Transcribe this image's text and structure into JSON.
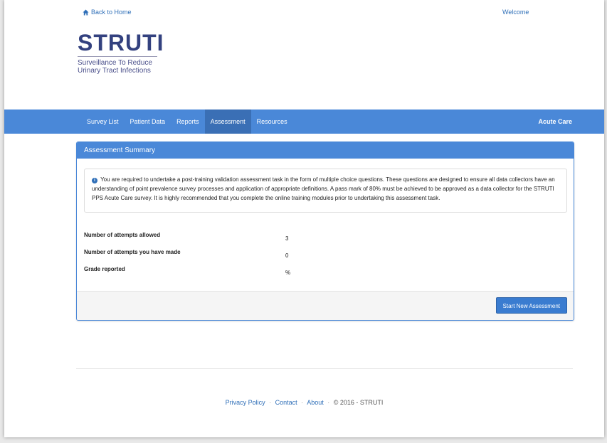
{
  "header": {
    "back_label": "Back to Home",
    "welcome_label": "Welcome"
  },
  "logo": {
    "title": "STRUTI",
    "subtitle_line1": "Surveillance To Reduce",
    "subtitle_line2": "Urinary Tract Infections"
  },
  "nav": {
    "items": [
      {
        "label": "Survey List"
      },
      {
        "label": "Patient Data"
      },
      {
        "label": "Reports"
      },
      {
        "label": "Assessment"
      },
      {
        "label": "Resources"
      }
    ],
    "active_index": 3,
    "right_label": "Acute Care"
  },
  "panel": {
    "heading": "Assessment Summary",
    "info_text": "You are required to undertake a post-training validation assessment task in the form of multiple choice questions. These questions are designed to ensure all data collectors have an understanding of point prevalence survey processes and application of appropriate definitions. A pass mark of 80% must be achieved to be approved as a data collector for the STRUTI PPS Acute Care survey. It is highly recommended that you complete the online training modules prior to undertaking this assessment task.",
    "stats": [
      {
        "label": "Number of attempts allowed",
        "value": "3"
      },
      {
        "label": "Number of attempts you have made",
        "value": "0"
      },
      {
        "label": "Grade reported",
        "value": "%"
      }
    ],
    "button_label": "Start New Assessment"
  },
  "footer": {
    "privacy": "Privacy Policy",
    "contact": "Contact",
    "about": "About",
    "copyright": "© 2016 - STRUTI",
    "separator": "·"
  },
  "colors": {
    "nav_bg": "#4a88d8",
    "nav_active": "#3a6fb5",
    "logo": "#33417f",
    "link": "#2f6fb8"
  }
}
